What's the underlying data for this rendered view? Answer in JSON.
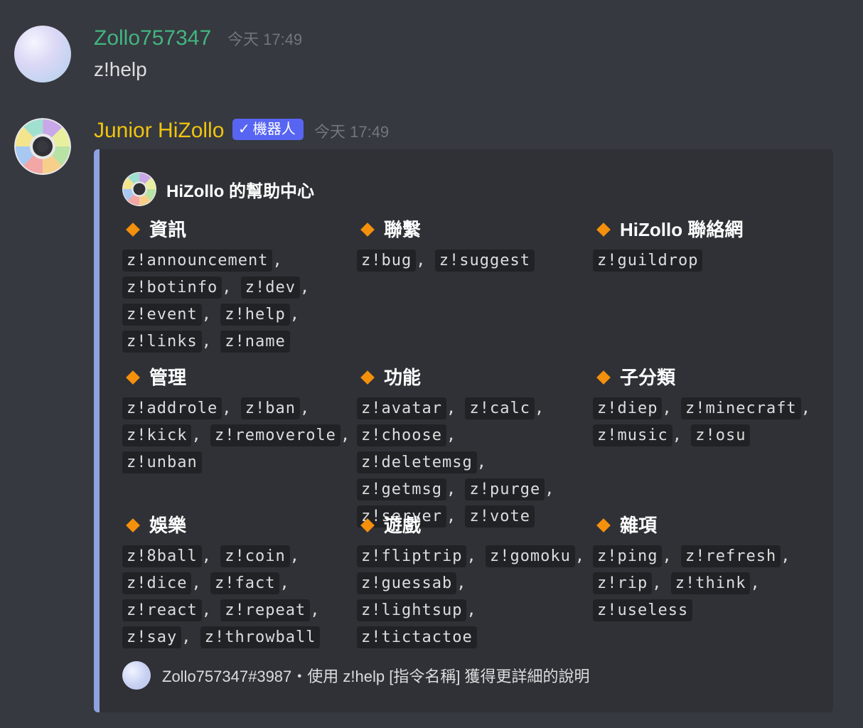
{
  "colors": {
    "user_name": "#43b581",
    "bot_name": "#f1c40f",
    "embed_border": "#8ea1e1",
    "bot_badge": "#5865f2",
    "diamond": "#f4900c"
  },
  "message1": {
    "author": "Zollo757347",
    "timestamp": "今天 17:49",
    "content": "z!help"
  },
  "message2": {
    "author": "Junior HiZollo",
    "badge_check": "✓",
    "badge": "機器人",
    "timestamp": "今天 17:49",
    "embed": {
      "author": "HiZollo 的幫助中心",
      "fields": [
        {
          "title": "資訊",
          "commands": [
            "z!announcement",
            "z!botinfo",
            "z!dev",
            "z!event",
            "z!help",
            "z!links",
            "z!name"
          ]
        },
        {
          "title": "聯繫",
          "commands": [
            "z!bug",
            "z!suggest"
          ]
        },
        {
          "title": "HiZollo 聯絡網",
          "commands": [
            "z!guildrop"
          ]
        },
        {
          "title": "管理",
          "commands": [
            "z!addrole",
            "z!ban",
            "z!kick",
            "z!removerole",
            "z!unban"
          ]
        },
        {
          "title": "功能",
          "commands": [
            "z!avatar",
            "z!calc",
            "z!choose",
            "z!deletemsg",
            "z!getmsg",
            "z!purge",
            "z!server",
            "z!vote"
          ]
        },
        {
          "title": "子分類",
          "commands": [
            "z!diep",
            "z!minecraft",
            "z!music",
            "z!osu"
          ]
        },
        {
          "title": "娛樂",
          "commands": [
            "z!8ball",
            "z!coin",
            "z!dice",
            "z!fact",
            "z!react",
            "z!repeat",
            "z!say",
            "z!throwball"
          ]
        },
        {
          "title": "遊戲",
          "commands": [
            "z!fliptrip",
            "z!gomoku",
            "z!guessab",
            "z!lightsup",
            "z!tictactoe"
          ]
        },
        {
          "title": "雜項",
          "commands": [
            "z!ping",
            "z!refresh",
            "z!rip",
            "z!think",
            "z!useless"
          ]
        }
      ],
      "footer": "Zollo757347#3987・使用 z!help [指令名稱] 獲得更詳細的說明"
    }
  }
}
